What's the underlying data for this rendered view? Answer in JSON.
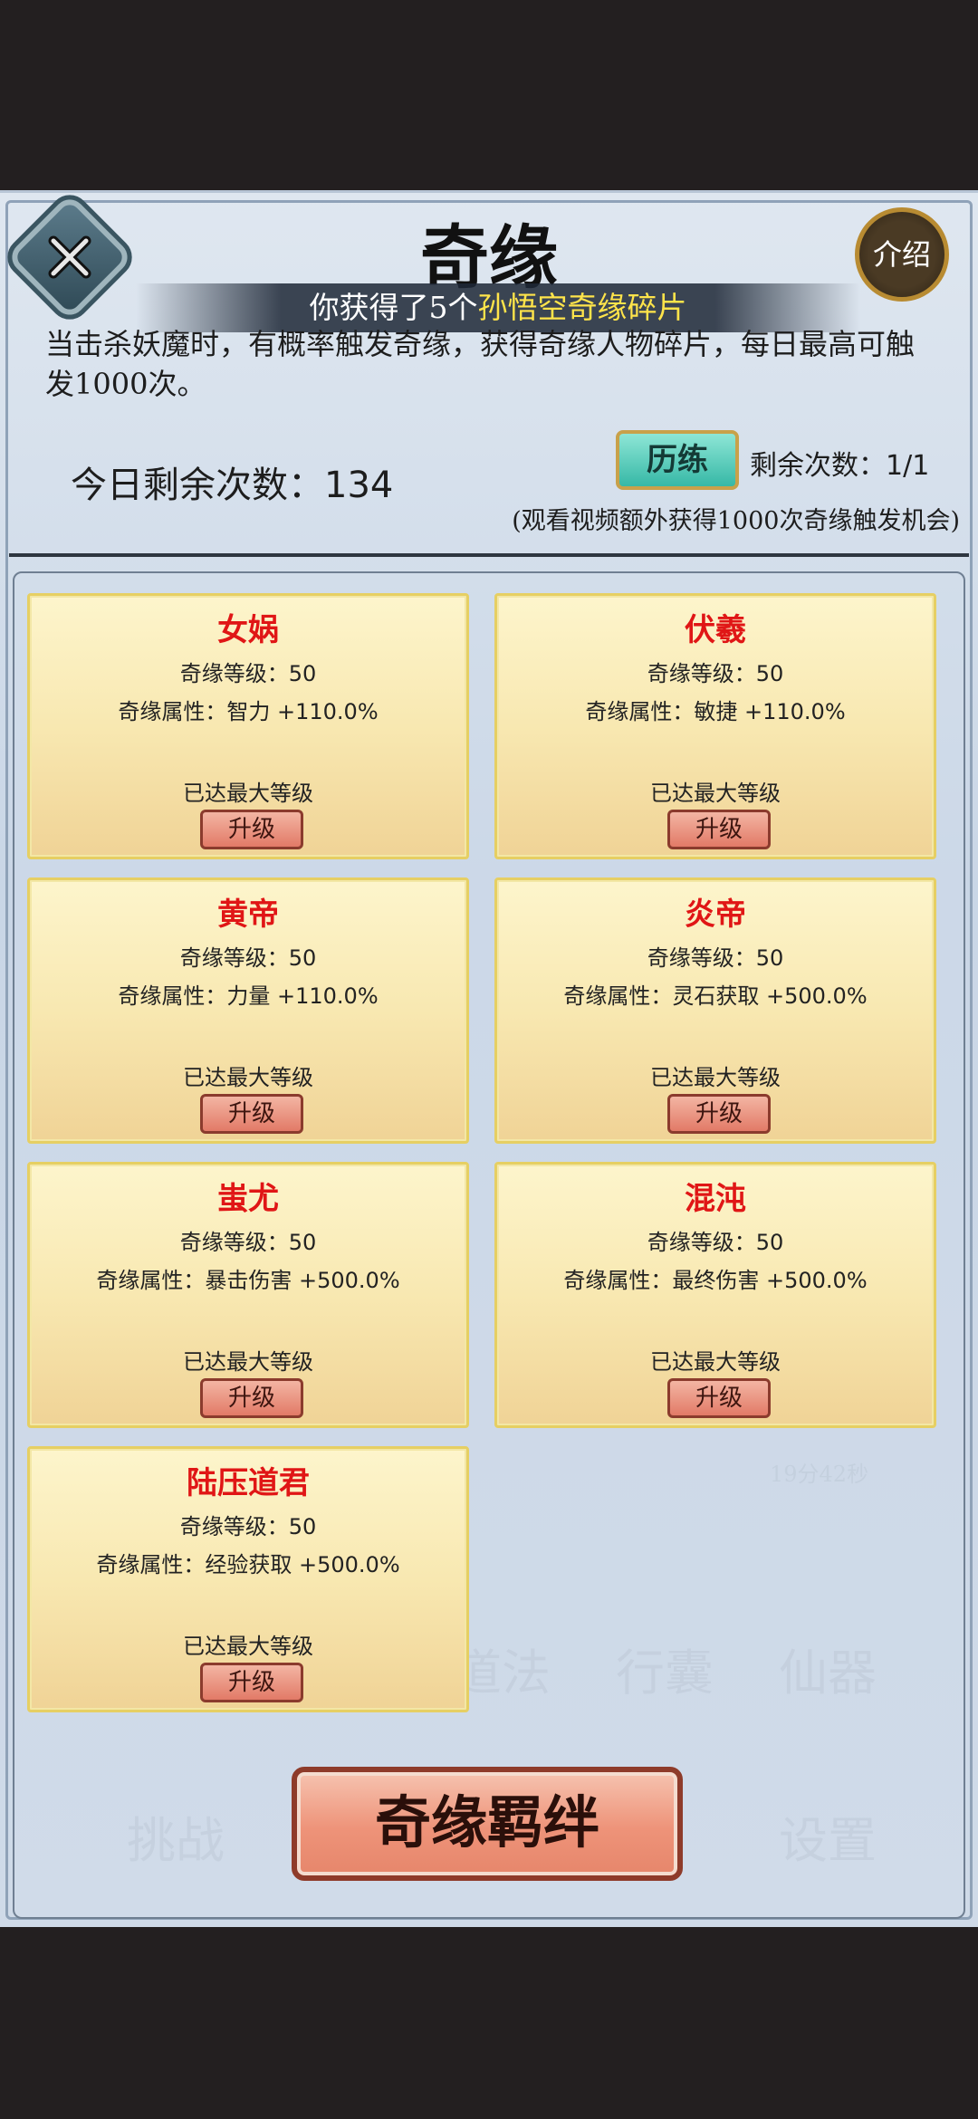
{
  "title": "奇缘",
  "intro_label": "介绍",
  "notice": {
    "prefix": "你获得了5个",
    "highlight": "孙悟空奇缘碎片"
  },
  "description": "当击杀妖魔时，有概率触发奇缘，获得奇缘人物碎片，每日最高可触发1000次。",
  "remaining_today": "今日剩余次数：134",
  "train_button": "历练",
  "train_remaining": "剩余次数：1/1",
  "video_note": "(观看视频额外获得1000次奇缘触发机会)",
  "cards": [
    {
      "name": "女娲",
      "level": "奇缘等级：50",
      "attr": "奇缘属性：智力 +110.0%",
      "status": "已达最大等级",
      "button": "升级"
    },
    {
      "name": "伏羲",
      "level": "奇缘等级：50",
      "attr": "奇缘属性：敏捷 +110.0%",
      "status": "已达最大等级",
      "button": "升级"
    },
    {
      "name": "黄帝",
      "level": "奇缘等级：50",
      "attr": "奇缘属性：力量 +110.0%",
      "status": "已达最大等级",
      "button": "升级"
    },
    {
      "name": "炎帝",
      "level": "奇缘等级：50",
      "attr": "奇缘属性：灵石获取 +500.0%",
      "status": "已达最大等级",
      "button": "升级"
    },
    {
      "name": "蚩尤",
      "level": "奇缘等级：50",
      "attr": "奇缘属性：暴击伤害 +500.0%",
      "status": "已达最大等级",
      "button": "升级"
    },
    {
      "name": "混沌",
      "level": "奇缘等级：50",
      "attr": "奇缘属性：最终伤害 +500.0%",
      "status": "已达最大等级",
      "button": "升级"
    },
    {
      "name": "陆压道君",
      "level": "奇缘等级：50",
      "attr": "奇缘属性：经验获取 +500.0%",
      "status": "已达最大等级",
      "button": "升级"
    }
  ],
  "bond_button": "奇缘羁绊",
  "background_ghost_text": [
    "道法",
    "行囊",
    "仙器",
    "挑战",
    "设置",
    "19分42秒"
  ]
}
